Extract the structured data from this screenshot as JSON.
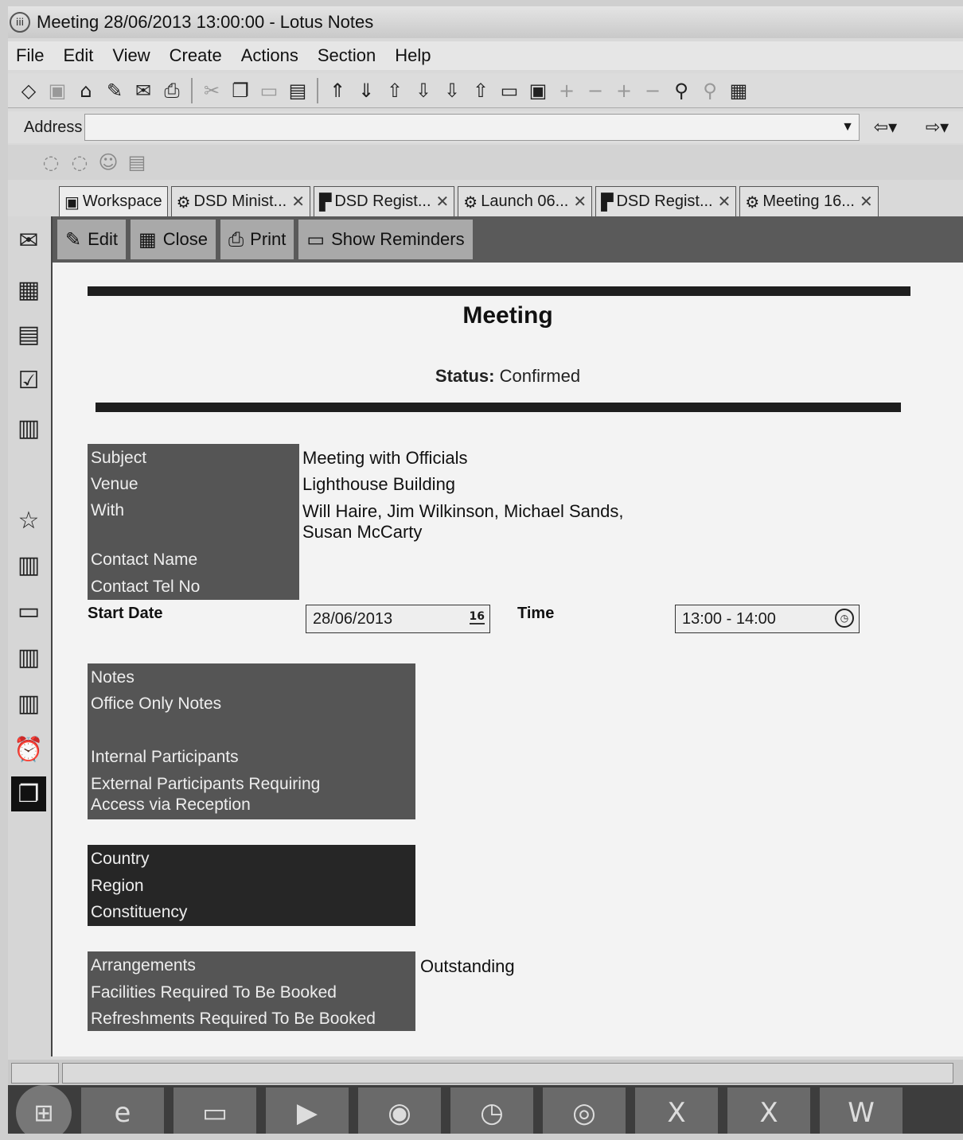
{
  "window": {
    "title": "Meeting 28/06/2013 13:00:00 - Lotus Notes"
  },
  "menu": [
    "File",
    "Edit",
    "View",
    "Create",
    "Actions",
    "Section",
    "Help"
  ],
  "address": {
    "label": "Address"
  },
  "tabs": [
    {
      "label": "Workspace",
      "icon": "workspace-icon"
    },
    {
      "label": "DSD Minist...",
      "icon": "gear-icon"
    },
    {
      "label": "DSD Regist...",
      "icon": "document-icon"
    },
    {
      "label": "Launch 06...",
      "icon": "calendar-entry-icon"
    },
    {
      "label": "DSD Regist...",
      "icon": "document-icon"
    },
    {
      "label": "Meeting 16...",
      "icon": "calendar-entry-icon"
    }
  ],
  "actions": {
    "edit": "Edit",
    "close": "Close",
    "print": "Print",
    "show_reminders": "Show Reminders"
  },
  "document": {
    "heading": "Meeting",
    "status_label": "Status:",
    "status_value": "Confirmed",
    "labels": {
      "subject": "Subject",
      "venue": "Venue",
      "with": "With",
      "contact_name": "Contact Name",
      "contact_tel": "Contact Tel No",
      "start_date": "Start Date",
      "time": "Time",
      "notes": "Notes",
      "office_notes": "Office Only Notes",
      "internal": "Internal Participants",
      "external_1": "External Participants Requiring",
      "external_2": "Access via Reception",
      "country": "Country",
      "region": "Region",
      "constituency": "Constituency",
      "arrangements": "Arrangements",
      "facilities": "Facilities Required To Be Booked",
      "refreshments": "Refreshments Required To Be Booked"
    },
    "values": {
      "subject": "Meeting with Officials",
      "venue": "Lighthouse Building",
      "with_1": "Will Haire, Jim Wilkinson, Michael Sands,",
      "with_2": "Susan McCarty",
      "start_date": "28/06/2013",
      "date_icon": "16",
      "time": "13:00 - 14:00",
      "arrangements": "Outstanding"
    }
  }
}
